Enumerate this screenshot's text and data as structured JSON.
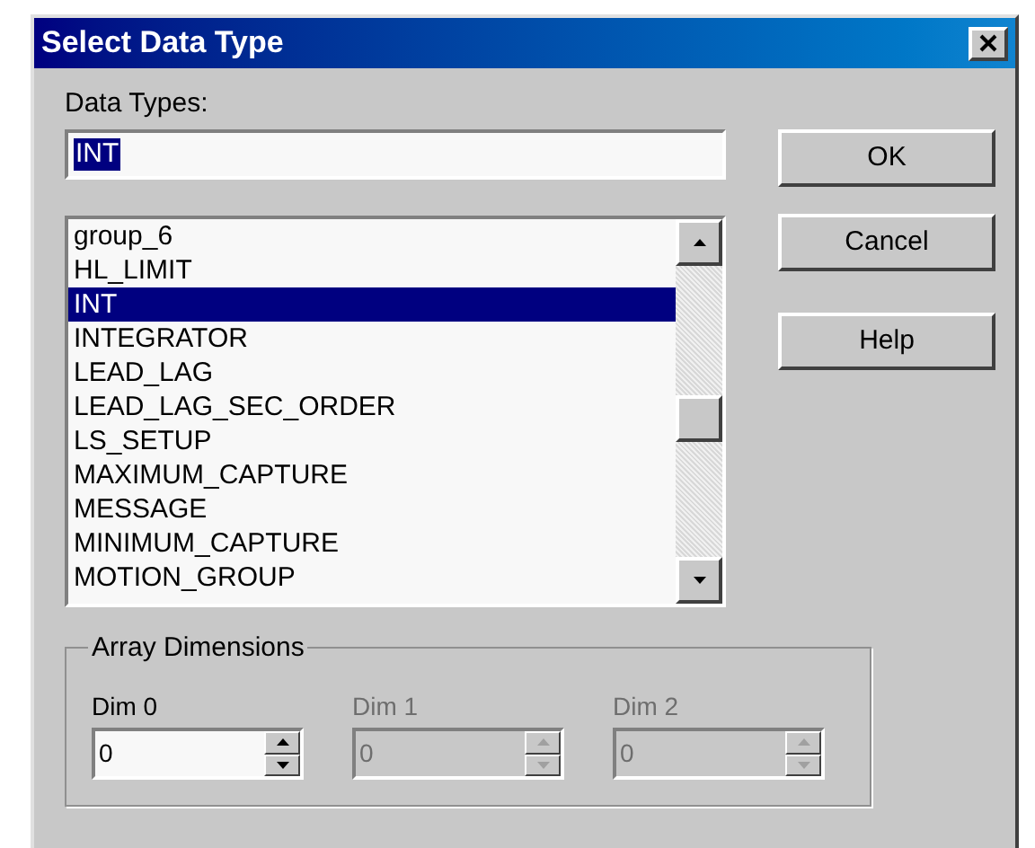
{
  "window": {
    "title": "Select Data Type"
  },
  "data_types": {
    "label": "Data Types:",
    "value": "INT",
    "text_selected": true
  },
  "list": {
    "items": [
      {
        "label": "group_6",
        "selected": false
      },
      {
        "label": "HL_LIMIT",
        "selected": false
      },
      {
        "label": "INT",
        "selected": true
      },
      {
        "label": "INTEGRATOR",
        "selected": false
      },
      {
        "label": "LEAD_LAG",
        "selected": false
      },
      {
        "label": "LEAD_LAG_SEC_ORDER",
        "selected": false
      },
      {
        "label": "LS_SETUP",
        "selected": false
      },
      {
        "label": "MAXIMUM_CAPTURE",
        "selected": false
      },
      {
        "label": "MESSAGE",
        "selected": false
      },
      {
        "label": "MINIMUM_CAPTURE",
        "selected": false
      },
      {
        "label": "MOTION_GROUP",
        "selected": false
      }
    ]
  },
  "buttons": [
    "OK",
    "Cancel",
    "Help"
  ],
  "array_dimensions": {
    "title": "Array Dimensions",
    "dims": [
      {
        "label": "Dim 0",
        "value": "0",
        "disabled": false
      },
      {
        "label": "Dim 1",
        "value": "0",
        "disabled": true
      },
      {
        "label": "Dim 2",
        "value": "0",
        "disabled": true
      }
    ]
  }
}
